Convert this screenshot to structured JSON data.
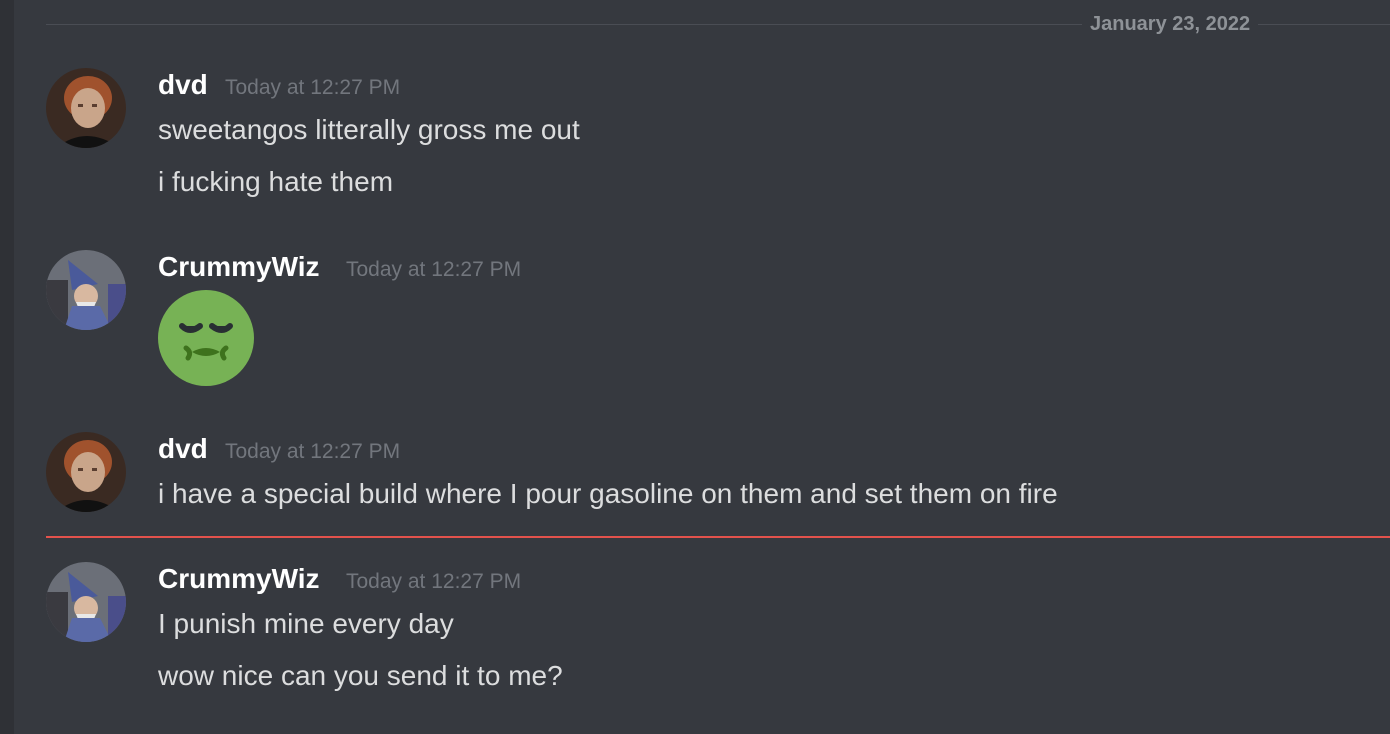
{
  "date_divider": {
    "label": "January 23, 2022"
  },
  "messages": [
    {
      "author": "dvd",
      "timestamp": "Today at 12:27 PM",
      "lines": [
        "sweetangos litterally gross me out",
        "i fucking hate them"
      ]
    },
    {
      "author": "CrummyWiz",
      "timestamp": "Today at 12:27 PM",
      "emoji": "nauseated-face-icon"
    },
    {
      "author": "dvd",
      "timestamp": "Today at 12:27 PM",
      "lines": [
        "i have a special build where I pour gasoline on them and set them on fire"
      ]
    },
    {
      "author": "CrummyWiz",
      "timestamp": "Today at 12:27 PM",
      "lines": [
        "I punish mine every day",
        "wow nice can you send it to me?"
      ]
    }
  ],
  "colors": {
    "background": "#36393f",
    "new_messages_divider": "#e3524c",
    "emoji_green": "#77b255"
  }
}
